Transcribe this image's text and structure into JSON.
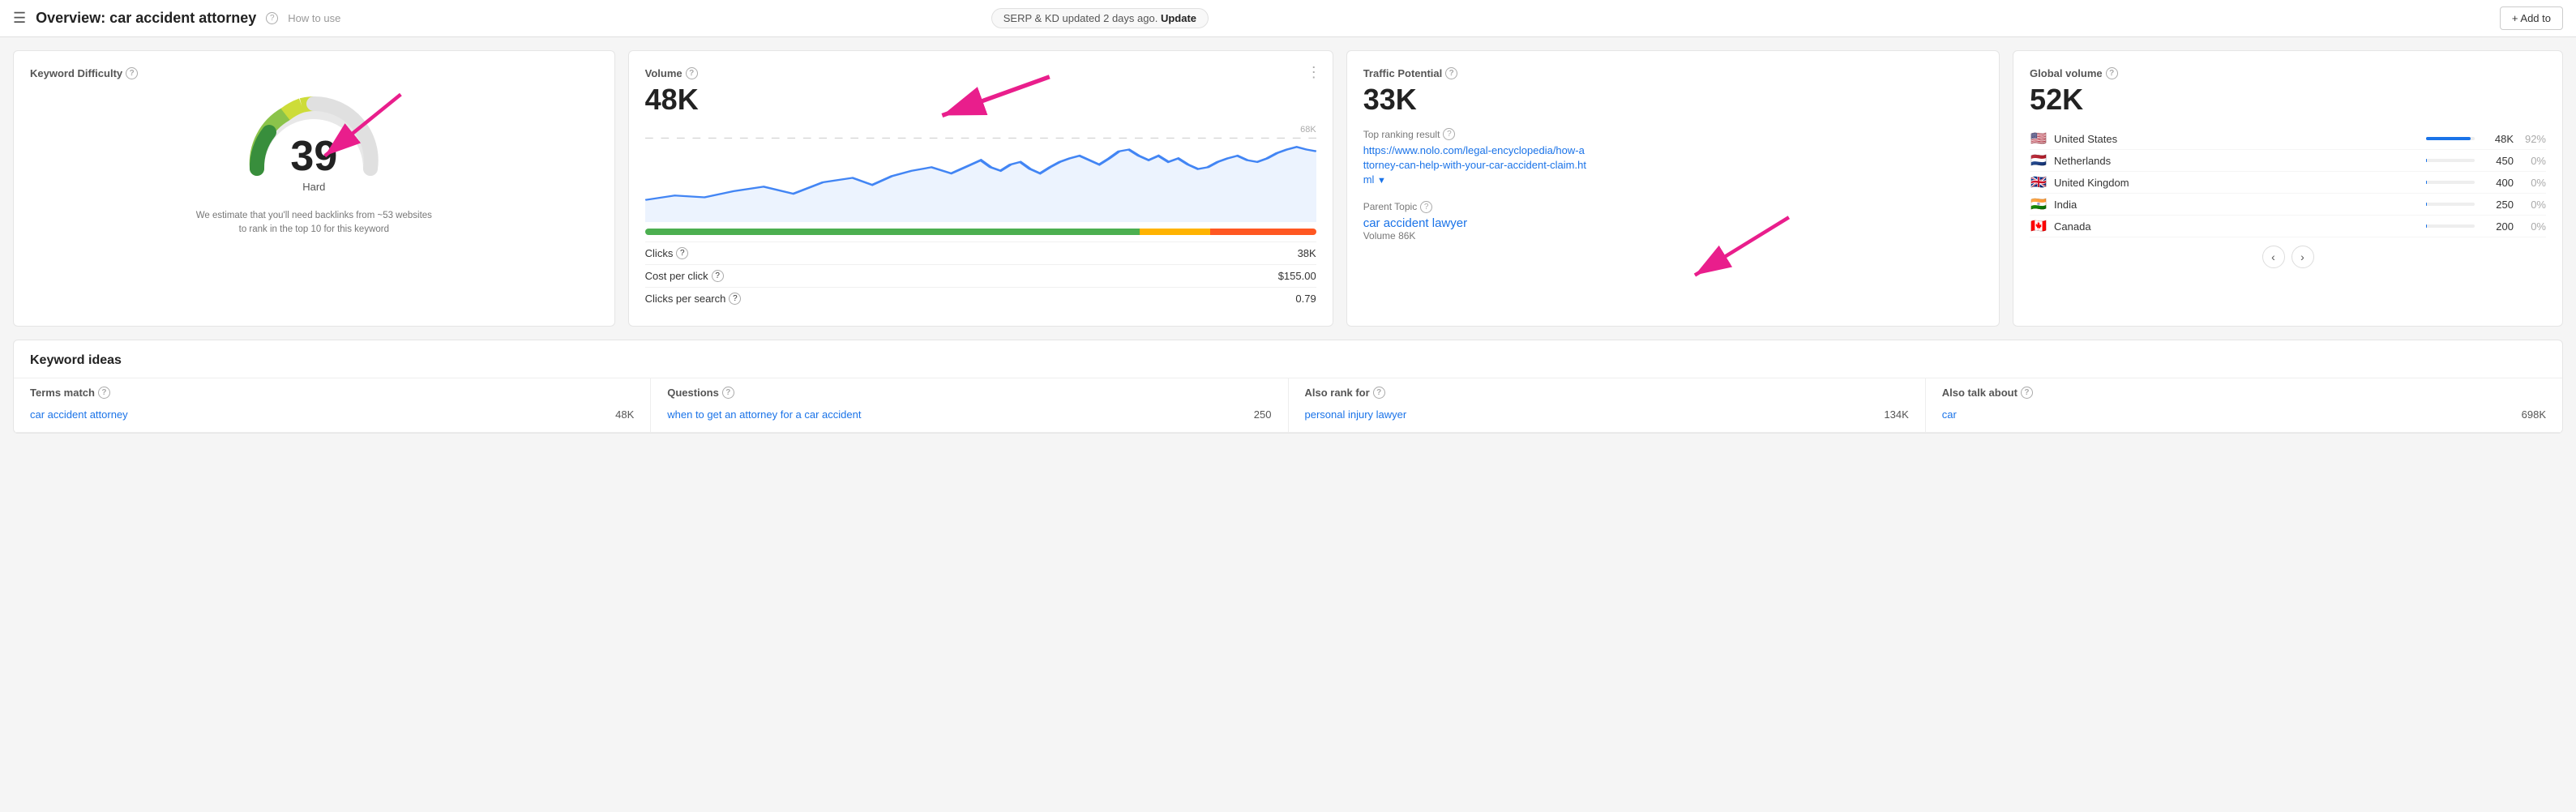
{
  "header": {
    "menu_icon": "☰",
    "title": "Overview: car accident attorney",
    "help_label": "How to use",
    "update_notice": "SERP & KD updated 2 days ago.",
    "update_link": "Update",
    "add_button": "+ Add to"
  },
  "kd_card": {
    "title": "Keyword Difficulty",
    "value": "39",
    "label": "Hard",
    "note": "We estimate that you'll need backlinks from ~53 websites\nto rank in the top 10 for this keyword"
  },
  "volume_card": {
    "title": "Volume",
    "value": "48K",
    "chart_max": "68K",
    "clicks_label": "Clicks",
    "clicks_value": "38K",
    "cpc_label": "Cost per click",
    "cpc_value": "$155.00",
    "cps_label": "Clicks per search",
    "cps_value": "0.79"
  },
  "traffic_card": {
    "title": "Traffic Potential",
    "value": "33K",
    "top_ranking_label": "Top ranking result",
    "top_ranking_url": "https://www.nolo.com/legal-encyclopedia/how-attorney-can-help-with-your-car-accident-claim.html",
    "top_ranking_display": "https://www.nolo.com/legal-encyclopedia/how-a\nttorney-can-help-with-your-car-accident-claim.ht\nml",
    "parent_topic_label": "Parent Topic",
    "parent_topic_name": "car accident lawyer",
    "parent_volume_label": "Volume 86K"
  },
  "global_volume_card": {
    "title": "Global volume",
    "value": "52K",
    "countries": [
      {
        "flag": "🇺🇸",
        "name": "United States",
        "volume": "48K",
        "pct": "92%",
        "bar": 92
      },
      {
        "flag": "🇳🇱",
        "name": "Netherlands",
        "volume": "450",
        "pct": "0%",
        "bar": 1
      },
      {
        "flag": "🇬🇧",
        "name": "United Kingdom",
        "volume": "400",
        "pct": "0%",
        "bar": 1
      },
      {
        "flag": "🇮🇳",
        "name": "India",
        "volume": "250",
        "pct": "0%",
        "bar": 1
      },
      {
        "flag": "🇨🇦",
        "name": "Canada",
        "volume": "200",
        "pct": "0%",
        "bar": 1
      }
    ],
    "prev_label": "‹",
    "next_label": "›"
  },
  "keyword_ideas": {
    "section_title": "Keyword ideas",
    "columns": [
      {
        "title": "Terms match",
        "items": [
          {
            "label": "car accident attorney",
            "value": "48K"
          }
        ]
      },
      {
        "title": "Questions",
        "items": [
          {
            "label": "when to get an attorney for a car accident",
            "value": "250"
          }
        ]
      },
      {
        "title": "Also rank for",
        "items": [
          {
            "label": "personal injury lawyer",
            "value": "134K"
          }
        ]
      },
      {
        "title": "Also talk about",
        "items": [
          {
            "label": "car",
            "value": "698K"
          }
        ]
      }
    ]
  }
}
